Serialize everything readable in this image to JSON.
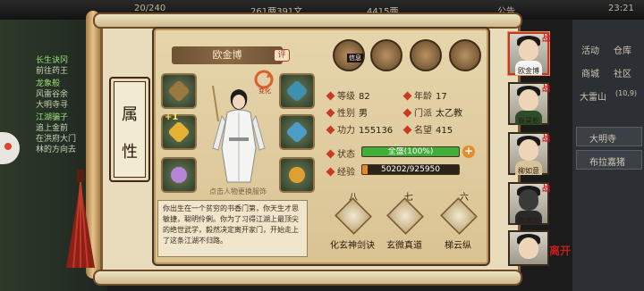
{
  "hud": {
    "energy": "20/240",
    "coins": "261两391文",
    "gold": "4415两",
    "notice": "公告",
    "time": "23:21",
    "quests": [
      "长生诀冈",
      "前往药王",
      "龙象般",
      "风雷谷余",
      "大明寺寻",
      "江湖骗子",
      "追上金前",
      "在洪府大门",
      "林的方向去"
    ],
    "menus": [
      {
        "a": "活动",
        "b": "仓库"
      },
      {
        "a": "商城",
        "b": "社区"
      },
      {
        "a": "大雷山",
        "b": "(10,9)"
      }
    ],
    "side_buttons": [
      "大明寺",
      "布拉嘉猪"
    ]
  },
  "tab": {
    "char1": "属",
    "char2": "性"
  },
  "character": {
    "name": "欧金博",
    "eval_badge": "评",
    "swap_label": "变化",
    "hint": "点击人物更换服饰",
    "bio": "你出生在一个贫穷的书香门第，你天生才思敏捷，聪明伶俐。你为了习得江湖上最顶尖的绝世武学，毅然决定离开家门，开始走上了这条江湖不归路。"
  },
  "top_icons": {
    "letter_label": "信息"
  },
  "stats": {
    "level_label": "等级",
    "level": "82",
    "age_label": "年龄",
    "age": "17",
    "gender_label": "性别",
    "gender": "男",
    "sect_label": "门派",
    "sect": "太乙教",
    "power_label": "功力",
    "power": "155136",
    "fame_label": "名望",
    "fame": "415",
    "status_label": "状态",
    "status": "全盛(100%)",
    "status_pct": 100,
    "exp_label": "经验",
    "exp": "50202/925950",
    "exp_fraction": 0.054
  },
  "skills": [
    {
      "rank": "八",
      "name": "化玄神剑诀"
    },
    {
      "rank": "七",
      "name": "玄微真道"
    },
    {
      "rank": "六",
      "name": "梯云纵"
    }
  ],
  "roster": [
    {
      "name": "欧金博",
      "badge": "战"
    },
    {
      "name": "商昊乾",
      "badge": "战"
    },
    {
      "name": "柳如意",
      "badge": "战"
    },
    {
      "name": "陶渊浚",
      "badge": "战"
    },
    {
      "name": "",
      "badge": ""
    }
  ],
  "corner_logo": "离开",
  "colors": {
    "status_fill": "#3fae3a",
    "exp_fill": "#e48a25",
    "accent": "#c23a22"
  }
}
